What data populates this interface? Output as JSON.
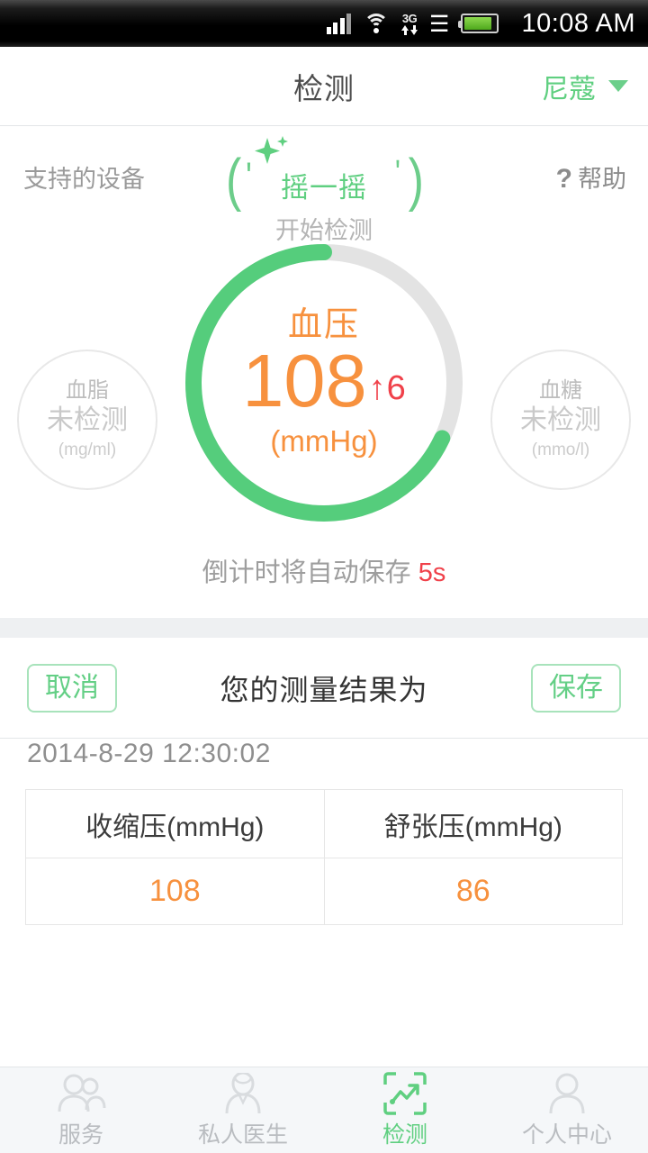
{
  "statusbar": {
    "time": "10:08 AM",
    "network_label": "3G",
    "icons": [
      "signal-icon",
      "wifi-icon",
      "3g-icon",
      "bluetooth-icon",
      "battery-icon"
    ]
  },
  "navbar": {
    "title": "检测",
    "user_name": "尼蔻"
  },
  "toolbar": {
    "supported_devices": "支持的设备",
    "help_mark": "?",
    "help_label": "帮助",
    "shake_label": "摇一摇",
    "shake_sub": "开始检测"
  },
  "gauge": {
    "title": "血压",
    "value": "108",
    "delta_arrow": "↑",
    "delta": "6",
    "unit": "(mmHg)",
    "progress_percent": 68,
    "arc_color": "#55cd7c",
    "track_color": "#e3e3e3",
    "value_color": "#f7913e",
    "delta_color": "#f0414a"
  },
  "side_metrics": [
    {
      "name": "血脂",
      "value": "未检测",
      "unit": "(mg/ml)"
    },
    {
      "name": "血糖",
      "value": "未检测",
      "unit": "(mmo/l)"
    }
  ],
  "countdown": {
    "text": "倒计时将自动保存",
    "seconds": "5s"
  },
  "result_bar": {
    "cancel_label": "取消",
    "title": "您的测量结果为",
    "save_label": "保存"
  },
  "record": {
    "datetime": "2014-8-29  12:30:02",
    "columns": [
      "收缩压(mmHg)",
      "舒张压(mmHg)"
    ],
    "values": [
      "108",
      "86"
    ]
  },
  "tabbar": {
    "items": [
      {
        "label": "服务",
        "icon": "people-icon",
        "active": false
      },
      {
        "label": "私人医生",
        "icon": "doctor-icon",
        "active": false
      },
      {
        "label": "检测",
        "icon": "chart-frame-icon",
        "active": true
      },
      {
        "label": "个人中心",
        "icon": "person-icon",
        "active": false
      }
    ]
  }
}
